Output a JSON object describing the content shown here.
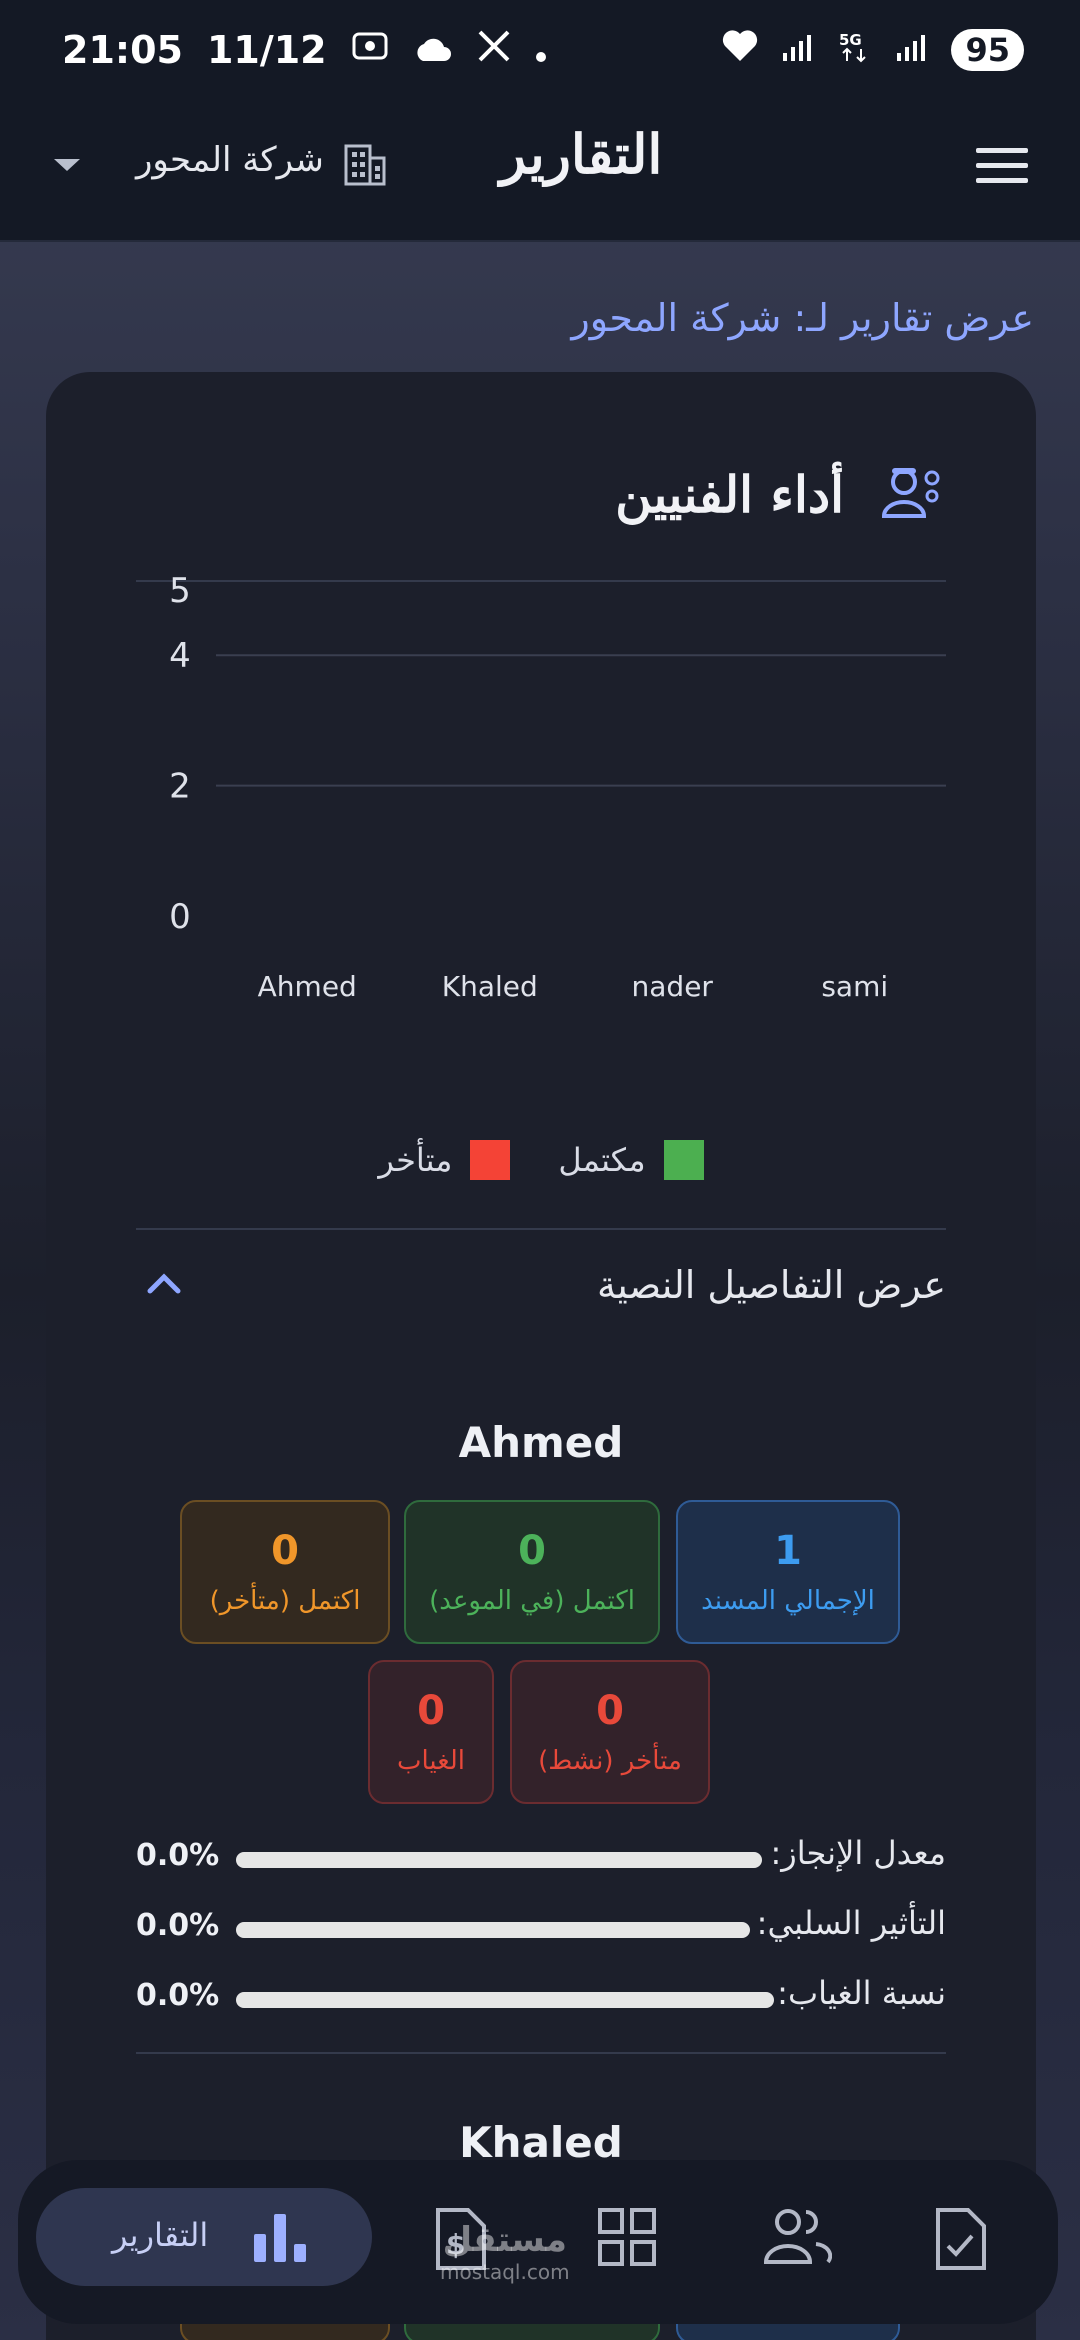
{
  "status_bar": {
    "time": "21:05",
    "date": "11/12",
    "battery": "95"
  },
  "app_bar": {
    "title": "التقارير",
    "company": "شركة المحور"
  },
  "subtitle": "عرض تقارير لـ: شركة المحور",
  "card": {
    "title": "أداء الفنيين"
  },
  "chart_data": {
    "type": "bar",
    "categories": [
      "Ahmed",
      "Khaled",
      "nader",
      "sami"
    ],
    "series": [
      {
        "name": "مكتمل",
        "values": [
          0,
          0,
          0,
          0
        ],
        "color": "#4caf50"
      },
      {
        "name": "متأخر",
        "values": [
          0,
          0,
          0,
          0
        ],
        "color": "#f44336"
      }
    ],
    "yticks": [
      "0",
      "2",
      "4",
      "5"
    ],
    "ylim": [
      0,
      5
    ],
    "grid": true,
    "legend": "bottom"
  },
  "details_toggle": {
    "label": "عرض التفاصيل النصية",
    "expanded": true
  },
  "technicians": [
    {
      "name": "Ahmed",
      "stats": {
        "total_assigned": {
          "value": "1",
          "label": "الإجمالي المسند"
        },
        "completed_on_time": {
          "value": "0",
          "label": "اكتمل (في الموعد)"
        },
        "completed_late": {
          "value": "0",
          "label": "اكتمل (متأخر)"
        },
        "late_active": {
          "value": "0",
          "label": "متأخر (نشط)"
        },
        "absence": {
          "value": "0",
          "label": "الغياب"
        }
      },
      "metrics": [
        {
          "label": "معدل الإنجاز:",
          "value": "0.0%"
        },
        {
          "label": "التأثير السلبي:",
          "value": "0.0%"
        },
        {
          "label": "نسبة الغياب:",
          "value": "0.0%"
        }
      ]
    },
    {
      "name": "Khaled"
    }
  ],
  "bottom_nav": {
    "active_label": "التقارير"
  },
  "watermark": {
    "arabic": "مستقل",
    "latin": "mostaql.com"
  }
}
